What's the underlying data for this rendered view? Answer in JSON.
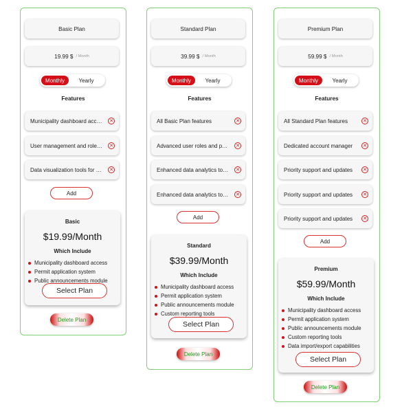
{
  "plans": [
    {
      "name_label": "Basic Plan",
      "price_amount": "19.99 $",
      "price_period": "/ Month",
      "toggle": {
        "monthly": "Monthly",
        "yearly": "Yearly"
      },
      "features_heading": "Features",
      "features": [
        "Municipality dashboard access",
        "User management and role assignment",
        "Data visualization tools for reports"
      ],
      "add_label": "Add",
      "card": {
        "name": "Basic",
        "price": "$19.99/Month",
        "includes_heading": "Which Include",
        "items": [
          "Municipality dashboard access",
          "Permit application system",
          "Public announcements module"
        ]
      },
      "select_label": "Select Plan",
      "delete_label": "Delete Plan"
    },
    {
      "name_label": "Standard Plan",
      "price_amount": "39.99 $",
      "price_period": "/ Month",
      "toggle": {
        "monthly": "Monthly",
        "yearly": "Yearly"
      },
      "features_heading": "Features",
      "features": [
        "All Basic Plan features",
        "Advanced user roles and permissions",
        "Enhanced data analytics toolkit",
        "Enhanced data analytics toolkit"
      ],
      "add_label": "Add",
      "card": {
        "name": "Standard",
        "price": "$39.99/Month",
        "includes_heading": "Which Include",
        "items": [
          "Municipality dashboard access",
          "Permit application system",
          "Public announcements module",
          "Custom reporting tools"
        ]
      },
      "select_label": "Select Plan",
      "delete_label": "Delete Plan"
    },
    {
      "name_label": "Premium Plan",
      "price_amount": "59.99 $",
      "price_period": "/ Month",
      "toggle": {
        "monthly": "Monthly",
        "yearly": "Yearly"
      },
      "features_heading": "Features",
      "features": [
        "All Standard Plan features",
        "Dedicated account manager",
        "Priority support and updates",
        "Priority support and updates",
        "Priority support and updates"
      ],
      "add_label": "Add",
      "card": {
        "name": "Premium",
        "price": "$59.99/Month",
        "includes_heading": "Which Include",
        "items": [
          "Municipality dashboard access",
          "Permit application system",
          "Public announcements module",
          "Custom reporting tools",
          "Data import/export capabilities"
        ]
      },
      "select_label": "Select Plan",
      "delete_label": "Delete Plan"
    }
  ],
  "icons": {
    "remove": "close-circle-icon"
  },
  "colors": {
    "accent": "#d40f18",
    "border": "#7fcf74",
    "delete_text": "#1e9a1e"
  }
}
